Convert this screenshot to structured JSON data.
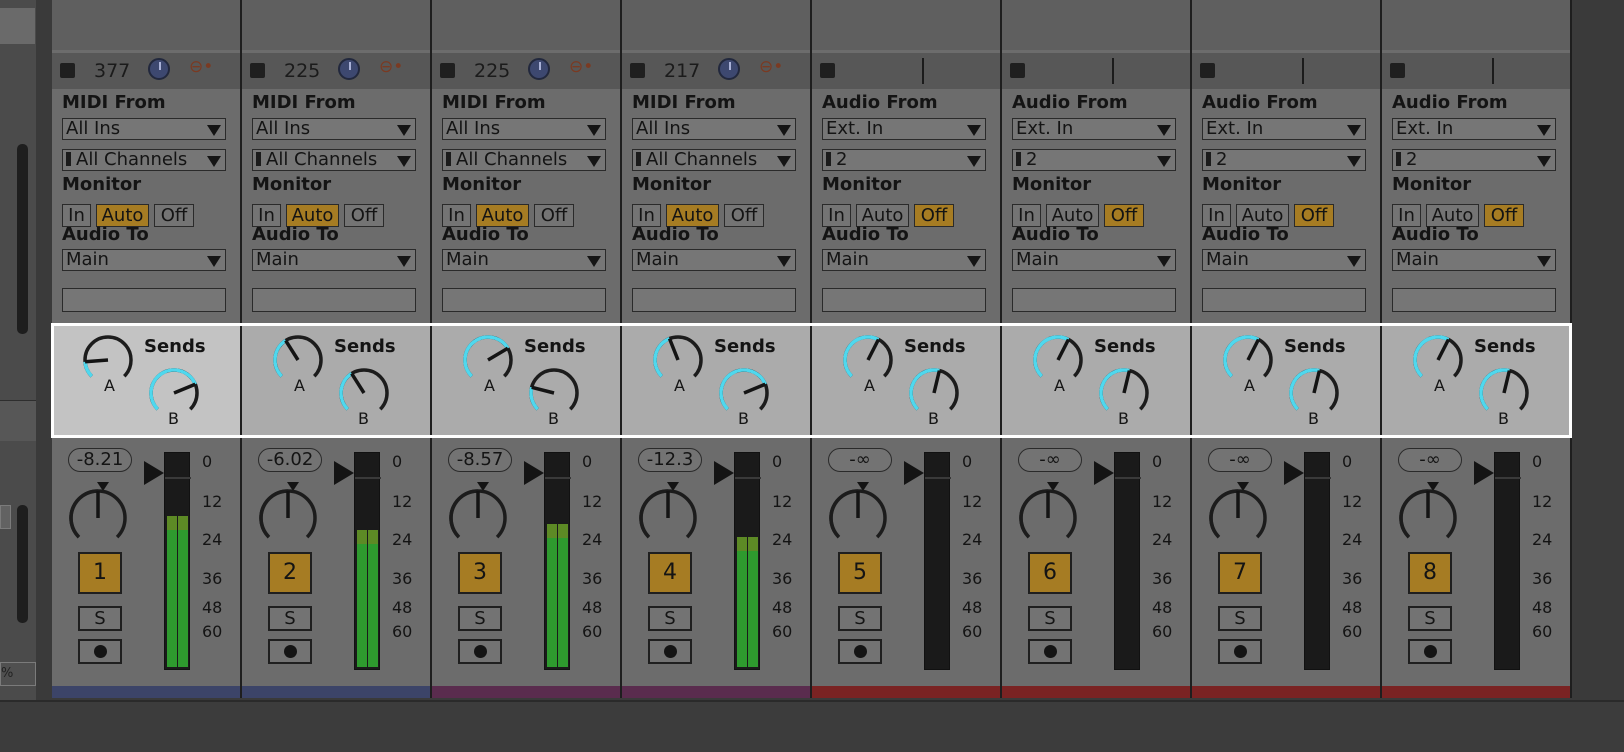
{
  "sends_title": "Sends",
  "send_a_label": "A",
  "send_b_label": "B",
  "monitor_label": "Monitor",
  "audio_to_label": "Audio To",
  "monitor_options": [
    "In",
    "Auto",
    "Off"
  ],
  "meter_scale": [
    "0",
    "12",
    "24",
    "36",
    "48",
    "60"
  ],
  "solo_label": "S",
  "tracks": [
    {
      "name_number": "1",
      "tempo": "377",
      "from_label": "MIDI From",
      "input_type": "All Ins",
      "channel": "All Channels",
      "monitor_active": "Auto",
      "output": "Main",
      "volume": "-8.21",
      "send_a": 0.15,
      "send_b": 0.75,
      "kind": "midi",
      "color": "#3c4468",
      "selected": true,
      "meter_level": 0.72
    },
    {
      "name_number": "2",
      "tempo": "225",
      "from_label": "MIDI From",
      "input_type": "All Ins",
      "channel": "All Channels",
      "monitor_active": "Auto",
      "output": "Main",
      "volume": "-6.02",
      "send_a": 0.38,
      "send_b": 0.38,
      "kind": "midi",
      "color": "#3c4468",
      "selected": false,
      "meter_level": 0.65
    },
    {
      "name_number": "3",
      "tempo": "225",
      "from_label": "MIDI From",
      "input_type": "All Ins",
      "channel": "All Channels",
      "monitor_active": "Auto",
      "output": "Main",
      "volume": "-8.57",
      "send_a": 0.72,
      "send_b": 0.22,
      "kind": "midi",
      "color": "#5a2c4e",
      "selected": false,
      "meter_level": 0.68
    },
    {
      "name_number": "4",
      "tempo": "217",
      "from_label": "MIDI From",
      "input_type": "All Ins",
      "channel": "All Channels",
      "monitor_active": "Auto",
      "output": "Main",
      "volume": "-12.3",
      "send_a": 0.42,
      "send_b": 0.75,
      "kind": "midi",
      "color": "#5a2c4e",
      "selected": false,
      "meter_level": 0.62
    },
    {
      "name_number": "5",
      "tempo": "",
      "from_label": "Audio From",
      "input_type": "Ext. In",
      "channel": "2",
      "monitor_active": "Off",
      "output": "Main",
      "volume": "-∞",
      "send_a": 0.6,
      "send_b": 0.55,
      "kind": "audio",
      "color": "#7a2323",
      "selected": false,
      "meter_level": 0
    },
    {
      "name_number": "6",
      "tempo": "",
      "from_label": "Audio From",
      "input_type": "Ext. In",
      "channel": "2",
      "monitor_active": "Off",
      "output": "Main",
      "volume": "-∞",
      "send_a": 0.6,
      "send_b": 0.55,
      "kind": "audio",
      "color": "#7a2323",
      "selected": false,
      "meter_level": 0
    },
    {
      "name_number": "7",
      "tempo": "",
      "from_label": "Audio From",
      "input_type": "Ext. In",
      "channel": "2",
      "monitor_active": "Off",
      "output": "Main",
      "volume": "-∞",
      "send_a": 0.6,
      "send_b": 0.55,
      "kind": "audio",
      "color": "#7a2323",
      "selected": false,
      "meter_level": 0
    },
    {
      "name_number": "8",
      "tempo": "",
      "from_label": "Audio From",
      "input_type": "Ext. In",
      "channel": "2",
      "monitor_active": "Off",
      "output": "Main",
      "volume": "-∞",
      "send_a": 0.6,
      "send_b": 0.55,
      "kind": "audio",
      "color": "#7a2323",
      "selected": false,
      "meter_level": 0
    }
  ],
  "left_panel_value": "%"
}
